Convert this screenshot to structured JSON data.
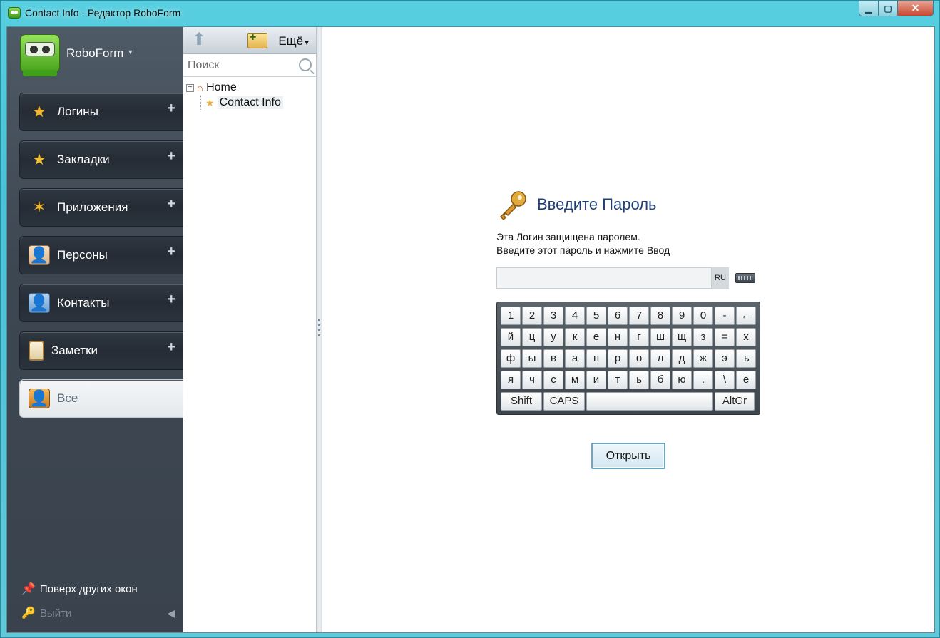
{
  "window": {
    "title": "Contact Info - Редактор RoboForm",
    "controls": {
      "minimize": "▁",
      "maximize": "▢",
      "close": "✕"
    }
  },
  "sidebar": {
    "brand": "RoboForm",
    "categories": [
      {
        "label": "Логины",
        "icon": "logins-star-icon",
        "plus": "+"
      },
      {
        "label": "Закладки",
        "icon": "bookmarks-star-icon",
        "plus": "+"
      },
      {
        "label": "Приложения",
        "icon": "apps-star-icon",
        "plus": "+"
      },
      {
        "label": "Персоны",
        "icon": "identity-card-icon",
        "plus": "+"
      },
      {
        "label": "Контакты",
        "icon": "contacts-card-icon",
        "plus": "+"
      },
      {
        "label": "Заметки",
        "icon": "notes-icon",
        "plus": "+"
      },
      {
        "label": "Все",
        "icon": "all-items-icon",
        "active": true
      }
    ],
    "always_on_top": "Поверх других окон",
    "logout": "Выйти"
  },
  "tree_panel": {
    "more_label": "Ещё",
    "search_placeholder": "Поиск",
    "tree": {
      "root": "Home",
      "child": "Contact Info"
    }
  },
  "password_dialog": {
    "title": "Введите Пароль",
    "message_line1": "Эта Логин защищена паролем.",
    "message_line2": "Введите этот пароль и нажмите Ввод",
    "password_value": "",
    "lang_indicator": "RU",
    "keyboard": {
      "row1": [
        "1",
        "2",
        "3",
        "4",
        "5",
        "6",
        "7",
        "8",
        "9",
        "0",
        "-",
        "←"
      ],
      "row2": [
        "й",
        "ц",
        "у",
        "к",
        "е",
        "н",
        "г",
        "ш",
        "щ",
        "з",
        "=",
        "х"
      ],
      "row3": [
        "ф",
        "ы",
        "в",
        "а",
        "п",
        "р",
        "о",
        "л",
        "д",
        "ж",
        "э",
        "ъ"
      ],
      "row4": [
        "я",
        "ч",
        "с",
        "м",
        "и",
        "т",
        "ь",
        "б",
        "ю",
        ".",
        "\\",
        "ё"
      ],
      "shift": "Shift",
      "caps": "CAPS",
      "altgr": "AltGr"
    },
    "open_button": "Открыть"
  }
}
